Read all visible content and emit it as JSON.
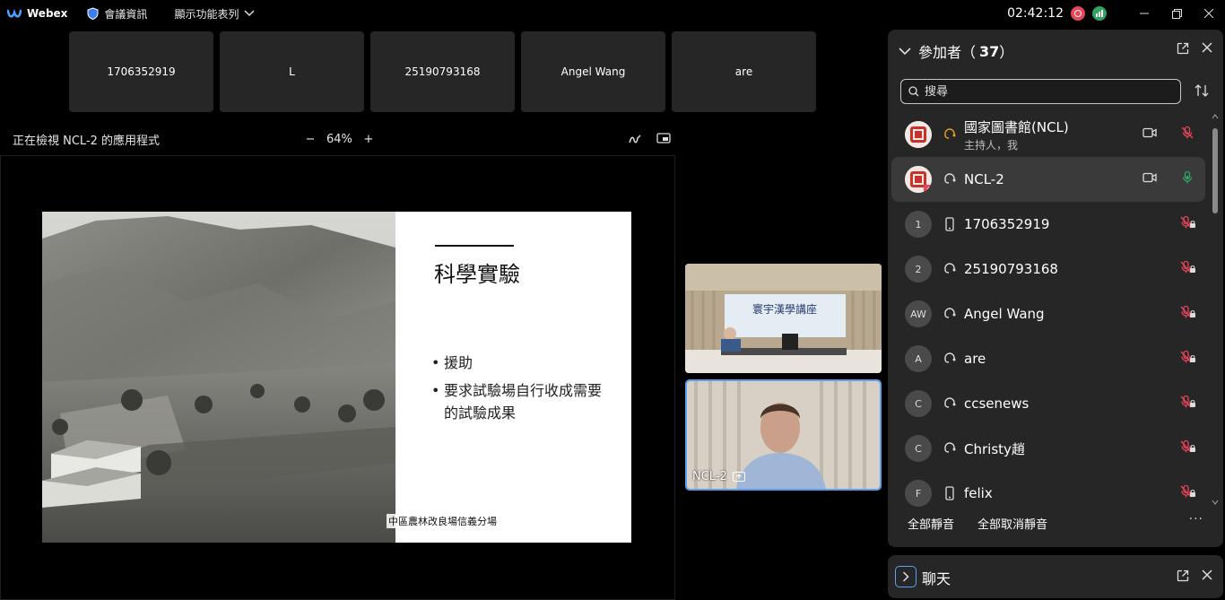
{
  "app": {
    "name": "Webex",
    "meeting_info": "會議資訊",
    "show_menu": "顯示功能表列",
    "clock": "02:42:12"
  },
  "thumbnails": [
    "1706352919",
    "L",
    "25190793168",
    "Angel Wang",
    "are"
  ],
  "share": {
    "label": "正在檢視 NCL-2 的應用程式",
    "zoom": "64%",
    "zoom_out": "−",
    "zoom_in": "+"
  },
  "slide": {
    "title": "科學實驗",
    "bullets": [
      "援助",
      "要求試驗場自行收成需要的試驗成果"
    ],
    "caption": "中區農林改良場信義分場"
  },
  "videos": {
    "tile1_banner": "寰宇漢學講座",
    "tile2_label": "NCL-2"
  },
  "participants_panel": {
    "title": "參加者",
    "count_open": "（",
    "count": "37",
    "count_close": "）",
    "search_placeholder": "搜尋",
    "items": [
      {
        "avatar": "",
        "name": "國家圖書館(NCL)",
        "sub": "主持人，我",
        "type": "headset",
        "video": "on",
        "mic": "muted"
      },
      {
        "avatar": "",
        "name": "NCL-2",
        "sub": "",
        "type": "headset",
        "video": "on",
        "mic": "active"
      },
      {
        "avatar": "1",
        "name": "1706352919",
        "sub": "",
        "type": "phone",
        "video": "",
        "mic": "muted"
      },
      {
        "avatar": "2",
        "name": "25190793168",
        "sub": "",
        "type": "headset",
        "video": "",
        "mic": "muted"
      },
      {
        "avatar": "AW",
        "name": "Angel Wang",
        "sub": "",
        "type": "headset",
        "video": "",
        "mic": "muted"
      },
      {
        "avatar": "A",
        "name": "are",
        "sub": "",
        "type": "headset",
        "video": "",
        "mic": "muted"
      },
      {
        "avatar": "C",
        "name": "ccsenews",
        "sub": "",
        "type": "headset",
        "video": "",
        "mic": "muted"
      },
      {
        "avatar": "C",
        "name": "Christy趙",
        "sub": "",
        "type": "headset",
        "video": "",
        "mic": "muted"
      },
      {
        "avatar": "F",
        "name": "felix",
        "sub": "",
        "type": "phone",
        "video": "",
        "mic": "muted"
      }
    ],
    "mute_all": "全部靜音",
    "unmute_all": "全部取消靜音",
    "more": "···"
  },
  "chat_panel": {
    "title": "聊天"
  },
  "colors": {
    "accent": "#5aa0f0",
    "muted_red": "#e8455a",
    "active_green": "#2fa560",
    "panel_bg": "#262626"
  }
}
